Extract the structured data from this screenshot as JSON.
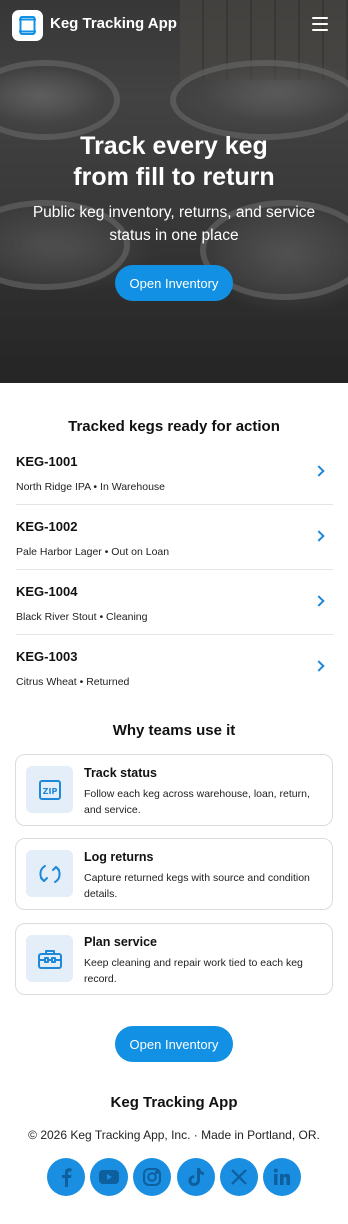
{
  "header": {
    "brand": "Keg Tracking App",
    "logo_icon": "keg-logo-icon",
    "menu_icon": "hamburger-menu-icon"
  },
  "hero": {
    "title_line1": "Track every keg",
    "title_line2": "from fill to return",
    "subtitle": "Public keg inventory, returns, and service status in one place",
    "cta": "Open Inventory"
  },
  "kegs": {
    "title": "Tracked kegs ready for action",
    "items": [
      {
        "id": "KEG-1001",
        "desc": "North Ridge IPA • In Warehouse"
      },
      {
        "id": "KEG-1002",
        "desc": "Pale Harbor Lager • Out on Loan"
      },
      {
        "id": "KEG-1004",
        "desc": "Black River Stout • Cleaning"
      },
      {
        "id": "KEG-1003",
        "desc": "Citrus Wheat • Returned"
      }
    ]
  },
  "features": {
    "title": "Why teams use it",
    "items": [
      {
        "title": "Track status",
        "desc": "Follow each keg across warehouse, loan, return, and service.",
        "icon": "zip-icon"
      },
      {
        "title": "Log returns",
        "desc": "Capture returned kegs with source and condition details.",
        "icon": "refresh-icon"
      },
      {
        "title": "Plan service",
        "desc": "Keep cleaning and repair work tied to each keg record.",
        "icon": "toolbox-icon"
      }
    ]
  },
  "cta_bottom": "Open Inventory",
  "footer": {
    "brand": "Keg Tracking App",
    "copyright": "© 2026 Keg Tracking App, Inc. · Made in Portland, OR.",
    "socials": [
      "facebook-icon",
      "youtube-icon",
      "instagram-icon",
      "tiktok-icon",
      "x-icon",
      "linkedin-icon"
    ]
  },
  "colors": {
    "accent": "#1291e4",
    "icon_bg": "#e3eef8",
    "social": "#1a8ee0"
  }
}
